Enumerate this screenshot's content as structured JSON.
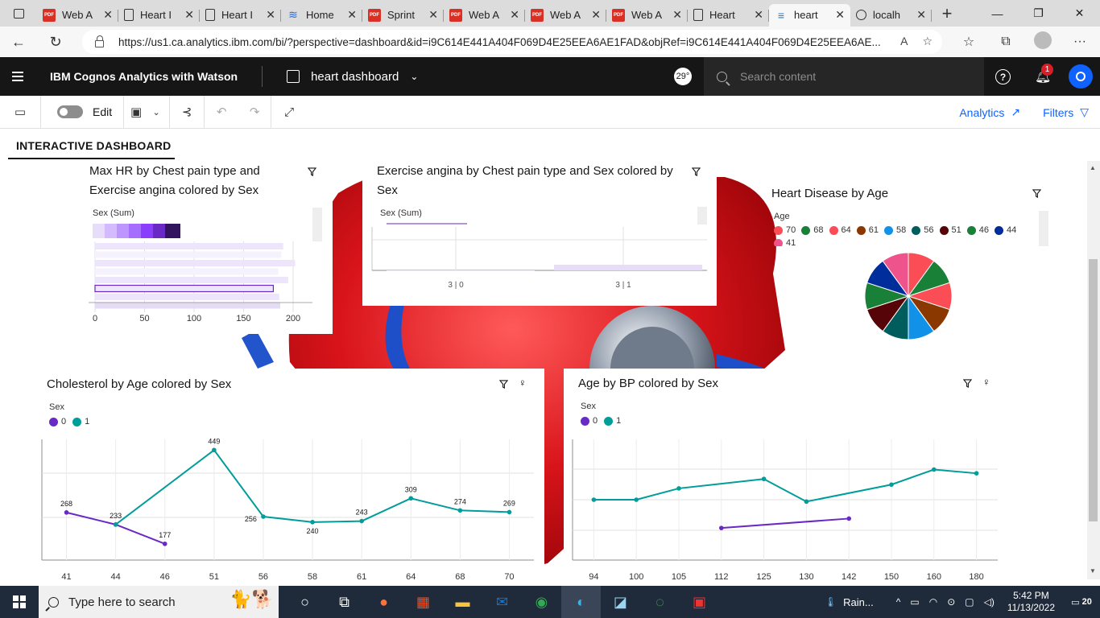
{
  "browser": {
    "tabs": [
      {
        "label": "Web A",
        "icon": "pdf-icon"
      },
      {
        "label": "Heart I",
        "icon": "document-icon"
      },
      {
        "label": "Heart I",
        "icon": "document-icon"
      },
      {
        "label": "Home",
        "icon": "home-icon"
      },
      {
        "label": "Sprint",
        "icon": "pdf-icon"
      },
      {
        "label": "Web A",
        "icon": "pdf-icon"
      },
      {
        "label": "Web A",
        "icon": "pdf-icon"
      },
      {
        "label": "Web A",
        "icon": "pdf-icon"
      },
      {
        "label": "Heart",
        "icon": "document-icon"
      },
      {
        "label": "heart",
        "icon": "cognos-icon",
        "active": true
      },
      {
        "label": "localh",
        "icon": "globe-icon"
      }
    ],
    "url": "https://us1.ca.analytics.ibm.com/bi/?perspective=dashboard&id=i9C614E441A404F069D4E25EEA6AE1FAD&objRef=i9C614E441A404F069D4E25EEA6AE..."
  },
  "app": {
    "title": "IBM Cognos Analytics with Watson",
    "dashboard_name": "heart dashboard",
    "temp_badge": "29°",
    "search_placeholder": "Search content",
    "notif_count": "1"
  },
  "toolbar": {
    "edit_label": "Edit",
    "analytics_label": "Analytics",
    "filters_label": "Filters"
  },
  "dashboard_tab": "INTERACTIVE DASHBOARD",
  "colors": {
    "sex0": "#6929c4",
    "sex1": "#1192e8",
    "teal": "#009d9a",
    "purple": "#6929c4"
  },
  "widgets": {
    "maxhr": {
      "title": "Max HR by Chest pain type and Exercise angina colored by Sex",
      "legend_title": "Sex (Sum)"
    },
    "exang": {
      "title": "Exercise angina by Chest pain type and Sex colored by Sex",
      "legend_title": "Sex (Sum)"
    },
    "hd_age": {
      "title": "Heart Disease by Age",
      "legend_title": "Age",
      "legend": [
        {
          "label": "70",
          "color": "#fa4d56"
        },
        {
          "label": "68",
          "color": "#198038"
        },
        {
          "label": "64",
          "color": "#fa4d56"
        },
        {
          "label": "61",
          "color": "#8a3800"
        },
        {
          "label": "58",
          "color": "#1192e8"
        },
        {
          "label": "56",
          "color": "#005d5d"
        },
        {
          "label": "51",
          "color": "#570408"
        },
        {
          "label": "46",
          "color": "#198038"
        },
        {
          "label": "44",
          "color": "#002d9c"
        },
        {
          "label": "41",
          "color": "#ee538b"
        }
      ]
    },
    "chol": {
      "title": "Cholesterol by Age colored by Sex",
      "legend_title": "Sex",
      "legend": [
        {
          "label": "0",
          "color": "#6929c4"
        },
        {
          "label": "1",
          "color": "#009d9a"
        }
      ]
    },
    "agebp": {
      "title": "Age by BP colored by Sex",
      "legend_title": "Sex",
      "legend": [
        {
          "label": "0",
          "color": "#6929c4"
        },
        {
          "label": "1",
          "color": "#009d9a"
        }
      ]
    }
  },
  "chart_data": [
    {
      "type": "bar",
      "orientation": "horizontal",
      "title": "Max HR by Chest pain type and Exercise angina colored by Sex",
      "x_ticks": [
        "0",
        "50",
        "100",
        "150",
        "200"
      ],
      "xlim": [
        0,
        200
      ],
      "values": [
        190,
        188,
        202,
        185,
        195,
        180,
        186,
        187
      ],
      "highlight_index": 5,
      "fill_colors": [
        "#ede5fb",
        "#f6f2fd",
        "#ede5fb",
        "#f6f2fd",
        "#ede5fb",
        "#ede5fb",
        "#ede5fb",
        "#e4dbf5"
      ]
    },
    {
      "type": "bar",
      "title": "Exercise angina by Chest pain type and Sex colored by Sex",
      "categories": [
        "3 | 0",
        "3 | 1"
      ],
      "values": [
        0,
        1
      ]
    },
    {
      "type": "pie",
      "title": "Heart Disease by Age",
      "slices": [
        {
          "label": "70",
          "value": 1,
          "color": "#fa4d56"
        },
        {
          "label": "68",
          "value": 1,
          "color": "#198038"
        },
        {
          "label": "64",
          "value": 1,
          "color": "#fa4d56"
        },
        {
          "label": "61",
          "value": 1,
          "color": "#8a3800"
        },
        {
          "label": "58",
          "value": 1,
          "color": "#1192e8"
        },
        {
          "label": "56",
          "value": 1,
          "color": "#005d5d"
        },
        {
          "label": "51",
          "value": 1,
          "color": "#570408"
        },
        {
          "label": "46",
          "value": 1,
          "color": "#198038"
        },
        {
          "label": "44",
          "value": 1,
          "color": "#002d9c"
        },
        {
          "label": "41",
          "value": 1,
          "color": "#ee538b"
        }
      ]
    },
    {
      "type": "line",
      "title": "Cholesterol by Age colored by Sex",
      "categories": [
        "41",
        "44",
        "46",
        "51",
        "56",
        "58",
        "61",
        "64",
        "68",
        "70"
      ],
      "ylim": [
        130,
        480
      ],
      "series": [
        {
          "name": "0",
          "color": "#6929c4",
          "points": [
            {
              "x": "41",
              "y": 268
            },
            {
              "x": "44",
              "y": 233
            },
            {
              "x": "46",
              "y": 177
            }
          ]
        },
        {
          "name": "1",
          "color": "#009d9a",
          "points": [
            {
              "x": "44",
              "y": 233
            },
            {
              "x": "51",
              "y": 449
            },
            {
              "x": "56",
              "y": 256
            },
            {
              "x": "58",
              "y": 240
            },
            {
              "x": "61",
              "y": 243
            },
            {
              "x": "64",
              "y": 309
            },
            {
              "x": "68",
              "y": 274
            },
            {
              "x": "70",
              "y": 269
            }
          ]
        }
      ],
      "labels": [
        {
          "x": "41",
          "y": 268,
          "text": "268",
          "pos": "above"
        },
        {
          "x": "44",
          "y": 233,
          "text": "233",
          "pos": "above"
        },
        {
          "x": "46",
          "y": 177,
          "text": "177",
          "pos": "above"
        },
        {
          "x": "51",
          "y": 449,
          "text": "449",
          "pos": "above"
        },
        {
          "x": "56",
          "y": 256,
          "text": "256",
          "pos": "left"
        },
        {
          "x": "58",
          "y": 240,
          "text": "240",
          "pos": "below"
        },
        {
          "x": "61",
          "y": 243,
          "text": "243",
          "pos": "above"
        },
        {
          "x": "64",
          "y": 309,
          "text": "309",
          "pos": "above"
        },
        {
          "x": "68",
          "y": 274,
          "text": "274",
          "pos": "above"
        },
        {
          "x": "70",
          "y": 269,
          "text": "269",
          "pos": "above"
        }
      ]
    },
    {
      "type": "line",
      "title": "Age by BP colored by Sex",
      "categories": [
        "94",
        "100",
        "105",
        "112",
        "125",
        "130",
        "142",
        "150",
        "160",
        "180"
      ],
      "ylim": [
        40,
        72
      ],
      "series": [
        {
          "name": "0",
          "color": "#6929c4",
          "points": [
            {
              "x": "112",
              "y": 48.5
            },
            {
              "x": "142",
              "y": 51
            }
          ]
        },
        {
          "name": "1",
          "color": "#009d9a",
          "points": [
            {
              "x": "94",
              "y": 56
            },
            {
              "x": "100",
              "y": 56
            },
            {
              "x": "105",
              "y": 59
            },
            {
              "x": "125",
              "y": 61.5
            },
            {
              "x": "130",
              "y": 55.5
            },
            {
              "x": "150",
              "y": 60
            },
            {
              "x": "160",
              "y": 64
            },
            {
              "x": "180",
              "y": 63
            }
          ]
        }
      ]
    }
  ],
  "taskbar": {
    "search_placeholder": "Type here to search",
    "weather": "Rain...",
    "time": "5:42 PM",
    "date": "11/13/2022",
    "notif_count": "20"
  }
}
